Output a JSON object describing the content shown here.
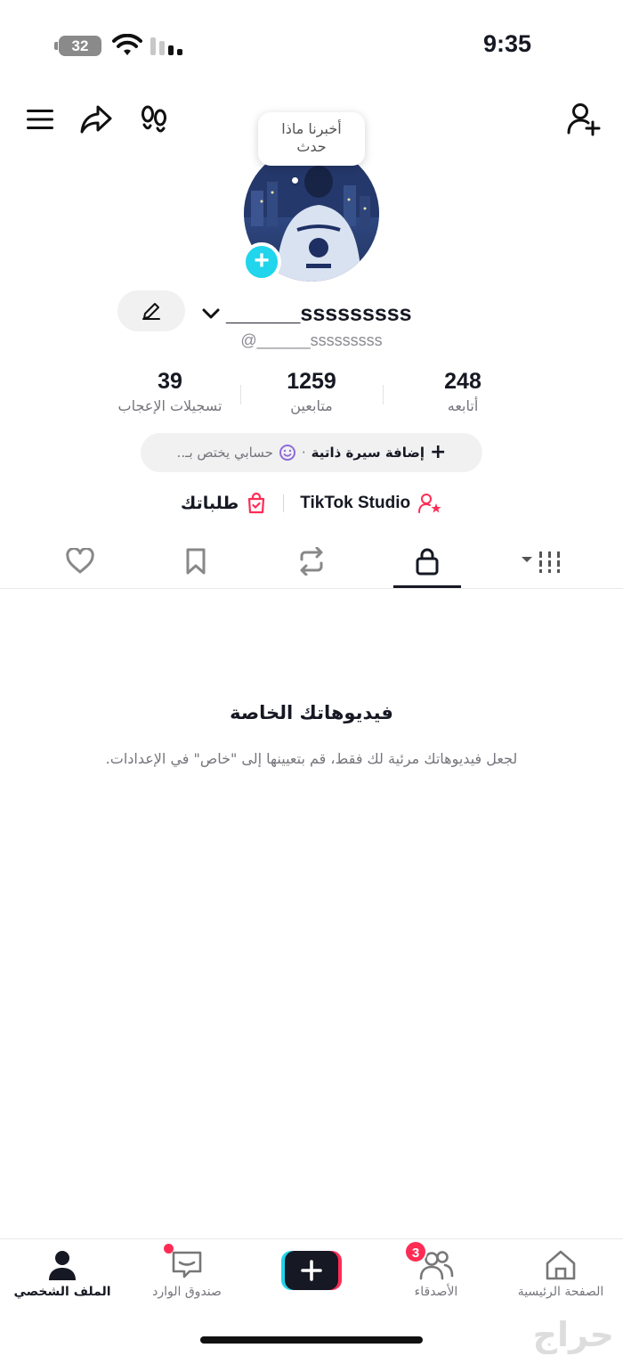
{
  "status_bar": {
    "time": "9:35",
    "battery": "32"
  },
  "tooltip": {
    "line1": "أخبرنا ماذا",
    "line2": "حدث"
  },
  "profile": {
    "username": "______sssssssss",
    "handle": "@______sssssssss"
  },
  "stats": [
    {
      "value": "248",
      "label": "أتابعه"
    },
    {
      "value": "1259",
      "label": "متابعين"
    },
    {
      "value": "39",
      "label": "تسجيلات الإعجاب"
    }
  ],
  "bio": {
    "add_label": "إضافة سيرة ذاتية",
    "hint": "حسابي يختص بـ..",
    "separator": "·"
  },
  "links": {
    "studio": "TikTok Studio",
    "orders": "طلباتك"
  },
  "tabs": [
    "videos",
    "private",
    "reposts",
    "favorites",
    "liked"
  ],
  "empty_state": {
    "title": "فيديوهاتك الخاصة",
    "description": "لجعل فيديوهاتك مرئية لك فقط، قم بتعيينها إلى \"خاص\" في الإعدادات."
  },
  "bottom_nav": {
    "home": "الصفحة الرئيسية",
    "friends": "الأصدقاء",
    "friends_badge": "3",
    "inbox": "صندوق الوارد",
    "profile": "الملف الشخصي"
  },
  "watermark": "حراج",
  "colors": {
    "accent_cyan": "#20d5ec",
    "accent_red": "#fe2c55",
    "text": "#161823",
    "muted": "#75767c"
  }
}
